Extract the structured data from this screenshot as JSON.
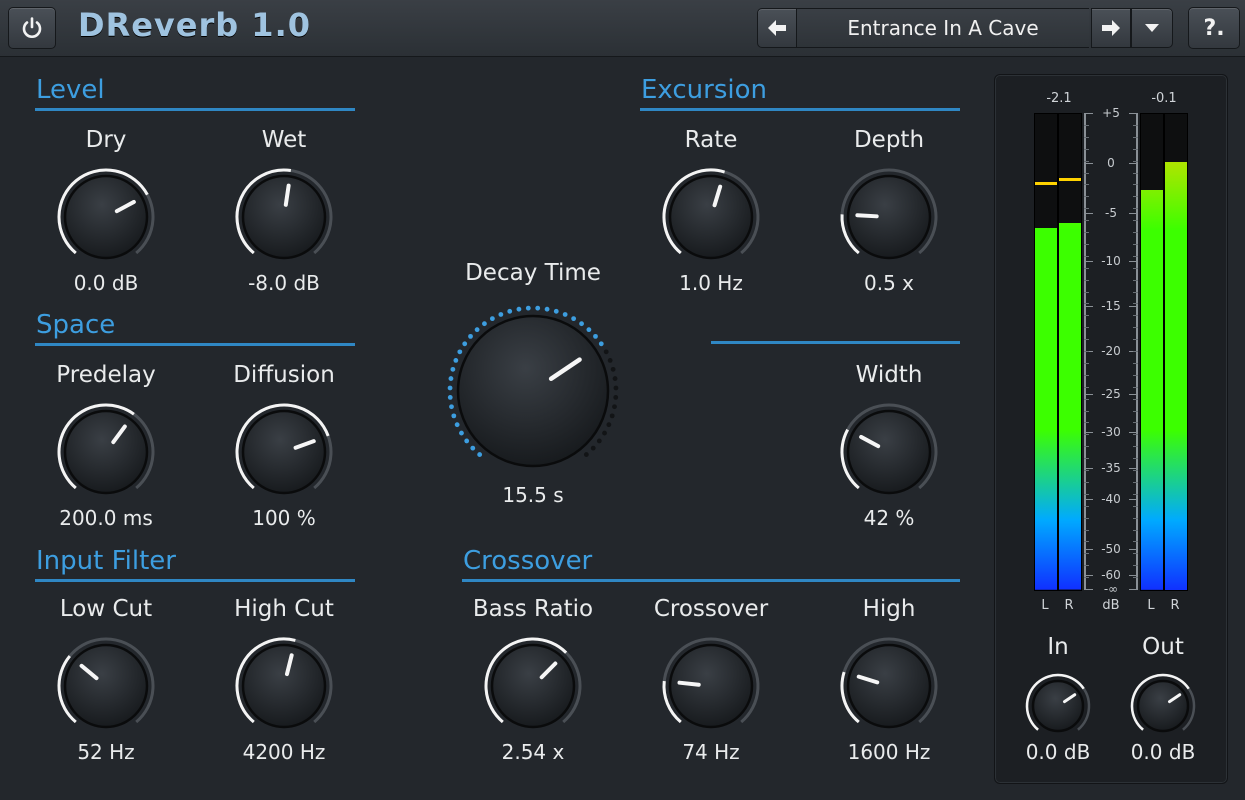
{
  "header": {
    "title": "DReverb 1.0",
    "preset_name": "Entrance In A Cave",
    "help_label": "?."
  },
  "sections": {
    "level": "Level",
    "space": "Space",
    "input_filter": "Input Filter",
    "excursion": "Excursion",
    "crossover": "Crossover"
  },
  "knobs": {
    "dry": {
      "label": "Dry",
      "value": "0.0 dB",
      "level": 0.72
    },
    "wet": {
      "label": "Wet",
      "value": "-8.0 dB",
      "level": 0.53
    },
    "predelay": {
      "label": "Predelay",
      "value": "200.0 ms",
      "level": 0.63
    },
    "diffusion": {
      "label": "Diffusion",
      "value": "100 %",
      "level": 0.75
    },
    "low_cut": {
      "label": "Low Cut",
      "value": "52 Hz",
      "level": 0.32
    },
    "high_cut": {
      "label": "High Cut",
      "value": "4200 Hz",
      "level": 0.55
    },
    "decay_time": {
      "label": "Decay Time",
      "value": "15.5 s",
      "level": 0.7
    },
    "rate": {
      "label": "Rate",
      "value": "1.0 Hz",
      "level": 0.56
    },
    "depth": {
      "label": "Depth",
      "value": "0.5 x",
      "level": 0.19
    },
    "width": {
      "label": "Width",
      "value": "42 %",
      "level": 0.28
    },
    "bass_ratio": {
      "label": "Bass Ratio",
      "value": "2.54 x",
      "level": 0.66
    },
    "crossover": {
      "label": "Crossover",
      "value": "74 Hz",
      "level": 0.2
    },
    "high": {
      "label": "High",
      "value": "1600 Hz",
      "level": 0.24
    },
    "in": {
      "label": "In",
      "value": "0.0 dB",
      "level": 0.7
    },
    "out": {
      "label": "Out",
      "value": "0.0 dB",
      "level": 0.7
    }
  },
  "meters": {
    "in_peak": "-2.1",
    "out_peak": "-0.1",
    "scale": [
      "+5",
      "0",
      "-5",
      "-10",
      "-15",
      "-20",
      "-25",
      "-30",
      "-35",
      "-40",
      "-50",
      "-60",
      "-∞"
    ],
    "scale_unit": "dB",
    "channel_l": "L",
    "channel_r": "R",
    "levels": {
      "in_l": 0.76,
      "in_r": 0.77,
      "out_l": 0.84,
      "out_r": 0.9
    },
    "peak_hold": {
      "in_l": 0.85,
      "in_r": 0.86
    },
    "colors": {
      "top": "#ffd200",
      "mid": "#3cff00",
      "bottom": "#1030ff",
      "accent": "#3d9ee0"
    }
  }
}
